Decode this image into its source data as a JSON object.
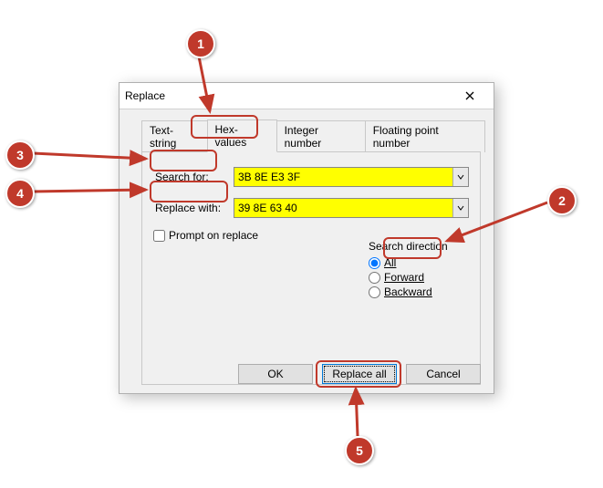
{
  "dialog": {
    "title": "Replace",
    "close_tooltip": "Close"
  },
  "tabs": {
    "text_string": "Text-string",
    "hex_values": "Hex-values",
    "integer": "Integer number",
    "float": "Floating point number"
  },
  "fields": {
    "search_for_label": "Search for:",
    "search_for_value": "3B 8E E3 3F",
    "replace_with_label": "Replace with:",
    "replace_with_value": "39 8E 63 40",
    "prompt_label": "Prompt on replace"
  },
  "direction": {
    "group_label": "Search direction",
    "all": "All",
    "forward": "Forward",
    "backward": "Backward"
  },
  "buttons": {
    "ok": "OK",
    "replace_all": "Replace all",
    "cancel": "Cancel"
  },
  "callouts": {
    "c1": "1",
    "c2": "2",
    "c3": "3",
    "c4": "4",
    "c5": "5"
  }
}
